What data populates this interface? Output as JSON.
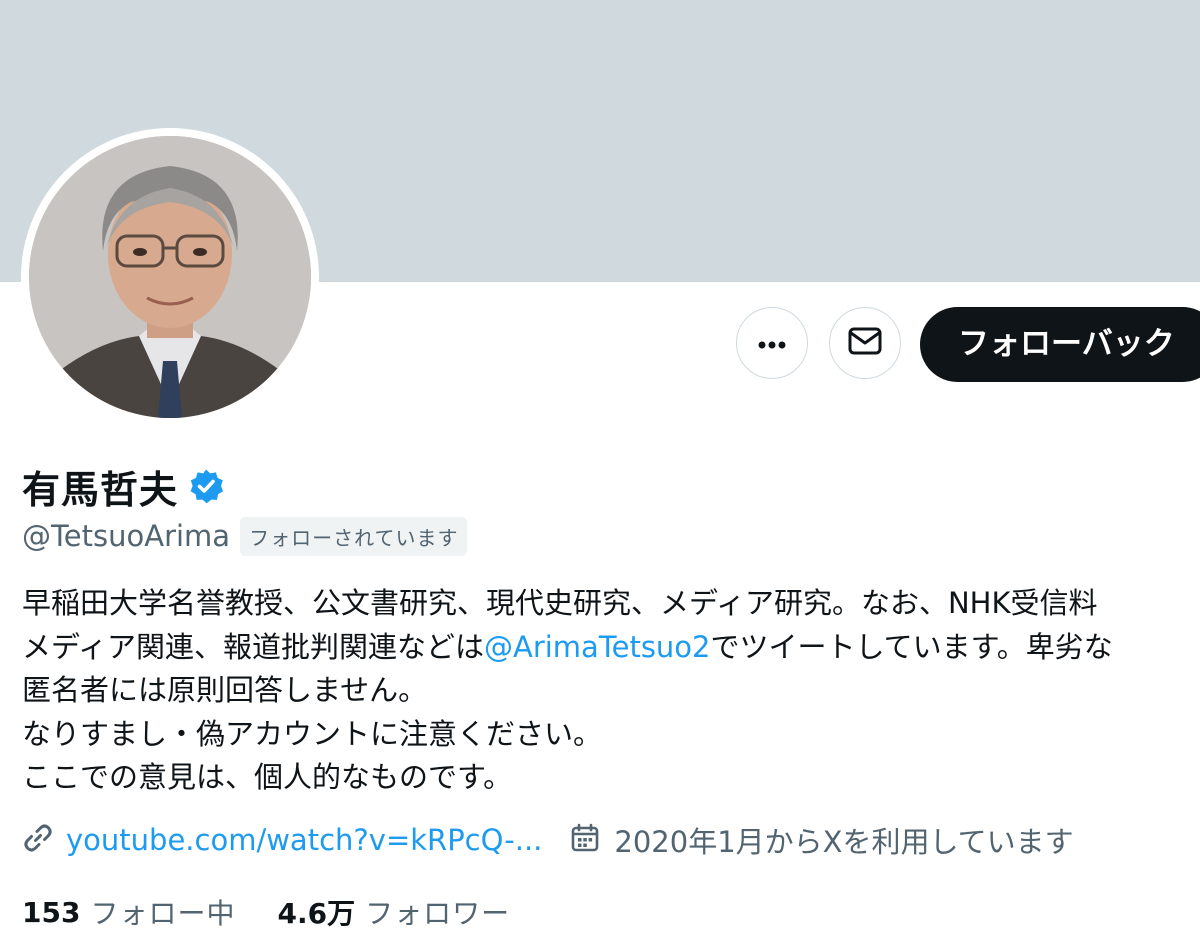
{
  "profile": {
    "display_name": "有馬哲夫",
    "handle": "@TetsuoArima",
    "follows_you_badge": "フォローされています",
    "verified_color": "#1d9bf0",
    "banner_color": "#cfd9de"
  },
  "actions": {
    "more_icon": "more-horizontal-icon",
    "message_icon": "envelope-icon",
    "follow_back_label": "フォローバック"
  },
  "bio": {
    "line1": "早稲田大学名誉教授、公文書研究、現代史研究、メディア研究。なお、NHK受信料",
    "line2_before": "メディア関連、報道批判関連などは",
    "line2_mention": "@ArimaTetsuo2",
    "line2_after": "でツイートしています。卑劣な",
    "line3": "匿名者には原則回答しません。",
    "line4": "なりすまし・偽アカウントに注意ください。",
    "line5": "ここでの意見は、個人的なものです。"
  },
  "meta": {
    "link_icon": "link-icon",
    "link_text": "youtube.com/watch?v=kRPcQ-...",
    "calendar_icon": "calendar-icon",
    "joined_text": "2020年1月からXを利用しています"
  },
  "stats": {
    "following_count": "153",
    "following_label": "フォロー中",
    "followers_count": "4.6万",
    "followers_label": "フォロワー"
  }
}
